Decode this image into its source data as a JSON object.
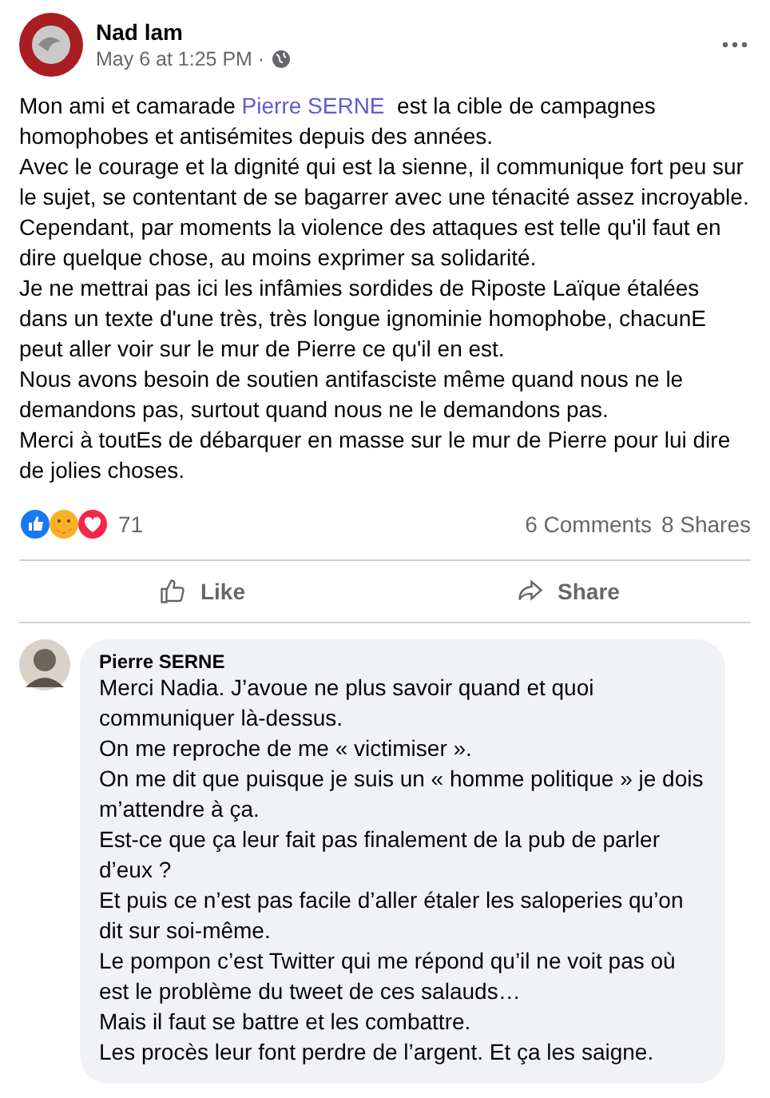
{
  "post": {
    "author": "Nad lam",
    "meta": "May 6 at 1:25 PM ·",
    "paragraphs": [
      [
        {
          "kind": "plain",
          "text": "Mon ami et camarade "
        },
        {
          "kind": "mention",
          "text": "Pierre SERNE"
        },
        {
          "kind": "plain",
          "text": "  est la cible de campagnes homophobes et antisémites depuis des années."
        }
      ],
      [
        {
          "kind": "plain",
          "text": "Avec le courage et la dignité qui est la sienne, il communique fort peu sur le sujet, se contentant de se bagarrer avec une ténacité assez incroyable."
        }
      ],
      [
        {
          "kind": "plain",
          "text": "Cependant, par moments la violence des attaques est telle qu'il faut en dire quelque chose, au moins exprimer sa solidarité."
        }
      ],
      [
        {
          "kind": "plain",
          "text": "Je ne mettrai pas ici les infâmies sordides de Riposte Laïque étalées dans un texte d'une très, très longue ignominie homophobe, chacunE peut aller voir sur le mur de Pierre ce qu'il en est."
        }
      ],
      [
        {
          "kind": "plain",
          "text": "Nous avons besoin de soutien antifasciste même quand nous ne le demandons pas, surtout quand nous ne le demandons pas."
        }
      ],
      [
        {
          "kind": "plain",
          "text": "Merci à toutEs de débarquer en masse sur le mur de Pierre pour lui dire de jolies choses."
        }
      ]
    ],
    "reactions": {
      "count": "71",
      "comments": "6 Comments",
      "shares": "8 Shares"
    },
    "actions": [
      {
        "kind": "like",
        "label": "Like"
      },
      {
        "kind": "share",
        "label": "Share"
      }
    ]
  },
  "comment": {
    "author": "Pierre SERNE",
    "lines": [
      "Merci Nadia. J’avoue ne plus savoir quand et quoi communiquer là-dessus.",
      "On me reproche de me « victimiser ».",
      "On me dit que puisque je suis un « homme politique » je dois m’attendre à ça.",
      "Est-ce que ça leur fait pas finalement de la pub de parler d’eux ?",
      "Et puis ce n’est pas facile d’aller étaler les saloperies qu’on dit sur soi-même.",
      "Le pompon c’est Twitter qui me répond qu’il ne voit pas où est le problème du tweet de ces salauds…",
      "Mais il faut se battre et les combattre.",
      "Les procès leur font perdre de l’argent. Et ça les saigne."
    ]
  }
}
